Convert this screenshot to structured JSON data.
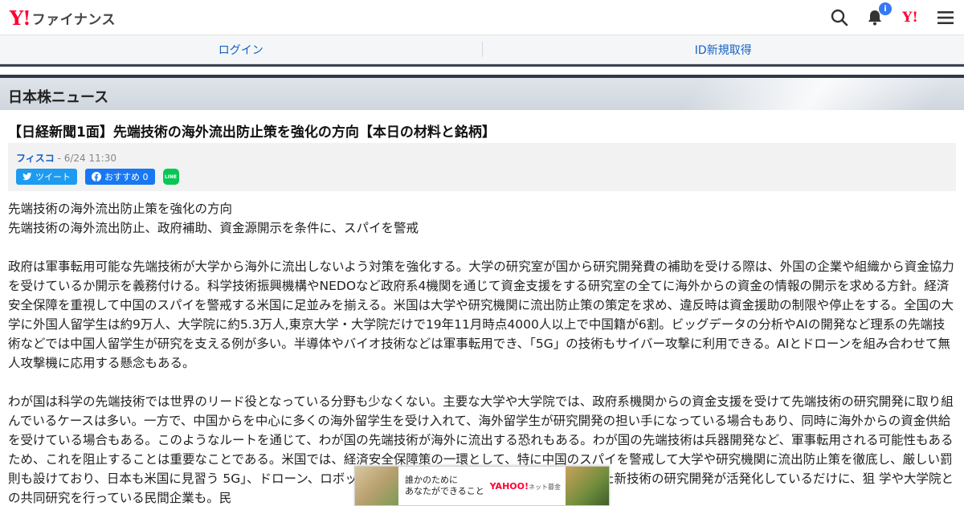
{
  "header": {
    "logo_y": "Y!",
    "logo_text": "ファイナンス",
    "notification_count": "i",
    "yahoo_mini": "Y!"
  },
  "loginbar": {
    "login": "ログイン",
    "register": "ID新規取得"
  },
  "section": {
    "title": "日本株ニュース"
  },
  "article": {
    "title": "【日経新聞1面】先端技術の海外流出防止策を強化の方向【本日の材料と銘柄】",
    "source": "フィスコ",
    "datetime": " - 6/24 11:30",
    "tweet_label": "ツイート",
    "fb_label": "おすすめ 0",
    "line_label": "LINE",
    "lead1": "先端技術の海外流出防止策を強化の方向",
    "lead2": "先端技術の海外流出防止、政府補助、資金源開示を条件に、スパイを警戒",
    "para1": "政府は軍事転用可能な先端技術が大学から海外に流出しないよう対策を強化する。大学の研究室が国から研究開発費の補助を受ける際は、外国の企業や組織から資金協力を受けているか開示を義務付ける。科学技術振興機構やNEDOなど政府系4機関を通じて資金支援をする研究室の全てに海外からの資金の情報の開示を求める方針。経済安全保障を重視して中国のスパイを警戒する米国に足並みを揃える。米国は大学や研究機関に流出防止策の策定を求め、違反時は資金援助の制限や停止をする。全国の大学に外国人留学生は約9万人、大学院に約5.3万人,東京大学・大学院だけで19年11月時点4000人以上で中国籍が6割。ビッグデータの分析やAIの開発など理系の先端技術などでは中国人留学生が研究を支える例が多い。半導体やバイオ技術などは軍事転用でき、「5G」の技術もサイバー攻撃に利用できる。AIとドローンを組み合わせて無人攻撃機に応用する懸念もある。",
    "para2": "わが国は科学の先端技術では世界のリード役となっている分野も少なくない。主要な大学や大学院では、政府系機関からの資金支援を受けて先端技術の研究開発に取り組んでいるケースは多い。一方で、中国からを中心に多くの海外留学生を受け入れて、海外留学生が研究開発の担い手になっている場合もあり、同時に海外からの資金供給を受けている場合もある。このようなルートを通じて、わが国の先端技術が海外に流出する恐れもある。わが国の先端技術は兵器開発など、軍事転用される可能性もあるため、これを阻止することは重要なことである。米国では、経済安全保障策の一環として、特に中国のスパイを警戒して大学や研究機関に流出防止策を徹底し、厳しい罰則も設けており、日本も米国に見習う 5G」、ドローン、ロボット、自動車分野でのCASEなど新時代に向けた新技術の研究開発が活発化しているだけに、狙 学や大学院との共同研究を行っている民間企業も。民"
  },
  "ad": {
    "line1": "誰かのために",
    "line2": "あなたができること",
    "brand": "YAHOO!",
    "brand_sub": "ネット募金"
  },
  "colors": {
    "yahoo_red": "#ff0033",
    "link_blue": "#1561c3",
    "twitter": "#1d9bf0",
    "facebook": "#1877f2",
    "line": "#06c755"
  }
}
